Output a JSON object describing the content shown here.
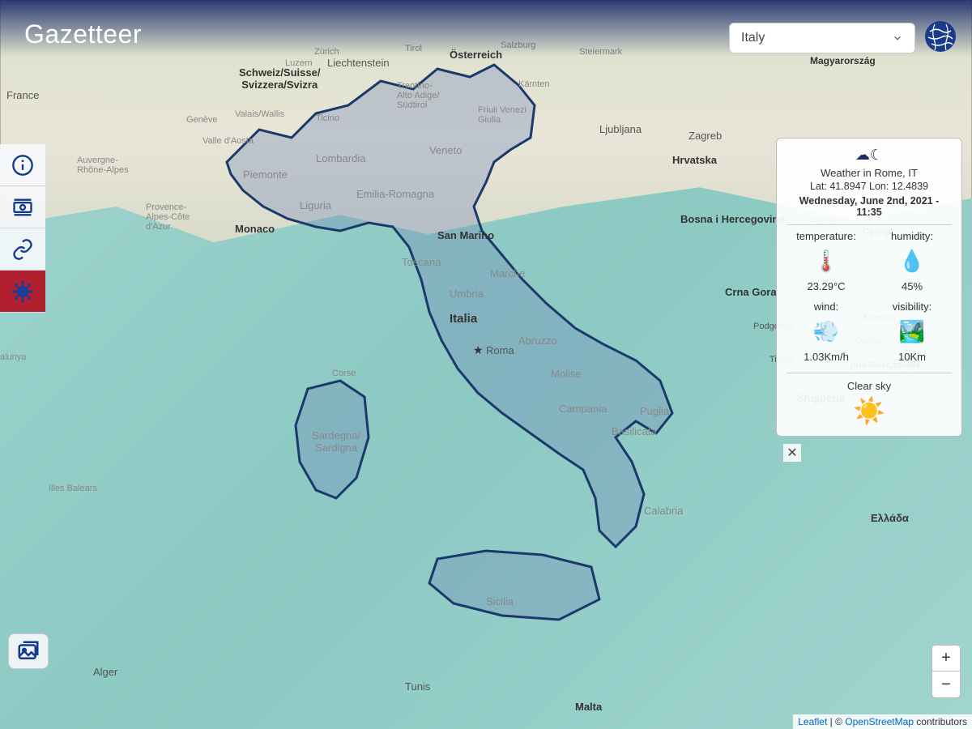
{
  "app": {
    "title": "Gazetteer"
  },
  "selector": {
    "value": "Italy"
  },
  "sidebar": {
    "items": [
      {
        "name": "info"
      },
      {
        "name": "currency"
      },
      {
        "name": "link"
      },
      {
        "name": "virus"
      }
    ]
  },
  "weather": {
    "location": "Weather in Rome, IT",
    "coords": "Lat: 41.8947 Lon: 12.4839",
    "datetime": "Wednesday, June 2nd, 2021 - 11:35",
    "temp_label": "temperature:",
    "humidity_label": "humidity:",
    "wind_label": "wind:",
    "visibility_label": "visibility:",
    "temp_value": "23.29°C",
    "humidity_value": "45%",
    "wind_value": "1.03Km/h",
    "visibility_value": "10Km",
    "description": "Clear sky"
  },
  "map_labels": {
    "france": "France",
    "osterreich": "Österreich",
    "schweiz": "Schweiz/Suisse/\nSvizzera/Svizra",
    "liechtenstein": "Liechtenstein",
    "ljubljana": "Ljubljana",
    "zagreb": "Zagreb",
    "hrvatska": "Hrvatska",
    "bosnia": "Bosna i Hercegovina",
    "crnagora": "Crna Gora",
    "monaco": "Monaco",
    "sanmarino": "San Marino",
    "italia": "Italia",
    "roma": "Roma",
    "malta": "Malta",
    "sicilia": "Sicilia",
    "sardegna": "Sardegna/\nSardigna",
    "toscana": "Toscana",
    "lombardia": "Lombardia",
    "piemonte": "Piemonte",
    "veneto": "Veneto",
    "puglia": "Puglia",
    "calabria": "Calabria",
    "liguria": "Liguria",
    "abruzzo": "Abruzzo",
    "molise": "Molise",
    "campania": "Campania",
    "basilicata": "Basilicata",
    "marche": "Marche",
    "umbria": "Umbria",
    "emilia": "Emilia-Romagna",
    "trentino": "Trentino-\nAlto Adige/\nSüdtirol",
    "friuli": "Friuli Venezi\nGiulia",
    "valle": "Valle d'Aosta",
    "ticino": "Ticino",
    "tirol": "Tirol",
    "karnten": "Kärnten",
    "salzburg": "Salzburg",
    "steiermark": "Steiermark",
    "geneve": "Genève",
    "luzern": "Luzern",
    "zurich": "Zürich",
    "valais": "Valais/Wallis",
    "auvergne": "Auvergne-\nRhône-Alpes",
    "provence": "Provence-\nAlpes-Côte\nd'Azur",
    "corse": "Corse",
    "illes": "Illes Balears",
    "catalunya": "alunya",
    "alger": "Alger",
    "tunis": "Tunis",
    "sarajevo": "Sarajevo",
    "podgorica": "Podgorica",
    "tirane": "Tiranë",
    "shqiperia": "Shqipëria",
    "kosovo": "Kosovo",
    "ellada": "Ελλάδα",
    "srbija": "Србија",
    "gora": "Гора",
    "skopje": "Скопје",
    "makedonija": "рна Македонија",
    "magyar": "Magyarország"
  },
  "zoom": {
    "in": "+",
    "out": "−"
  },
  "attribution": {
    "leaflet": "Leaflet",
    "sep": " | © ",
    "osm": "OpenStreetMap",
    "tail": " contributors"
  }
}
